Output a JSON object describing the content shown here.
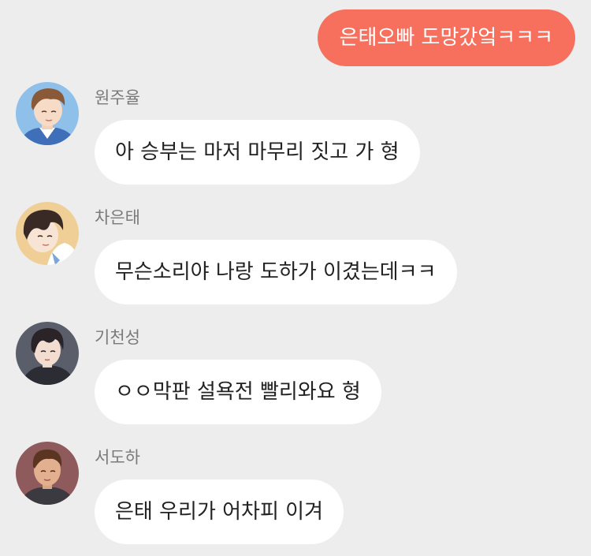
{
  "outgoing": {
    "text": "은태오빠 도망갔엌ㅋㅋㅋ",
    "bubble_color": "#f7705e"
  },
  "messages": [
    {
      "sender": "원주율",
      "text": "아 승부는 마저 마무리 짓고 가 형",
      "avatar_icon": "avatar-wonjuyul-icon"
    },
    {
      "sender": "차은태",
      "text": "무슨소리야 나랑 도하가 이겼는데ㅋㅋ",
      "avatar_icon": "avatar-chaeuntae-icon"
    },
    {
      "sender": "기천성",
      "text": "ㅇㅇ막판 설욕전 빨리와요 형",
      "avatar_icon": "avatar-gicheonseong-icon"
    },
    {
      "sender": "서도하",
      "text": "은태 우리가 어차피 이겨",
      "avatar_icon": "avatar-seodoha-icon"
    }
  ],
  "colors": {
    "background": "#ededed",
    "incoming_bubble": "#ffffff",
    "sender_name": "#7a7a7a"
  }
}
